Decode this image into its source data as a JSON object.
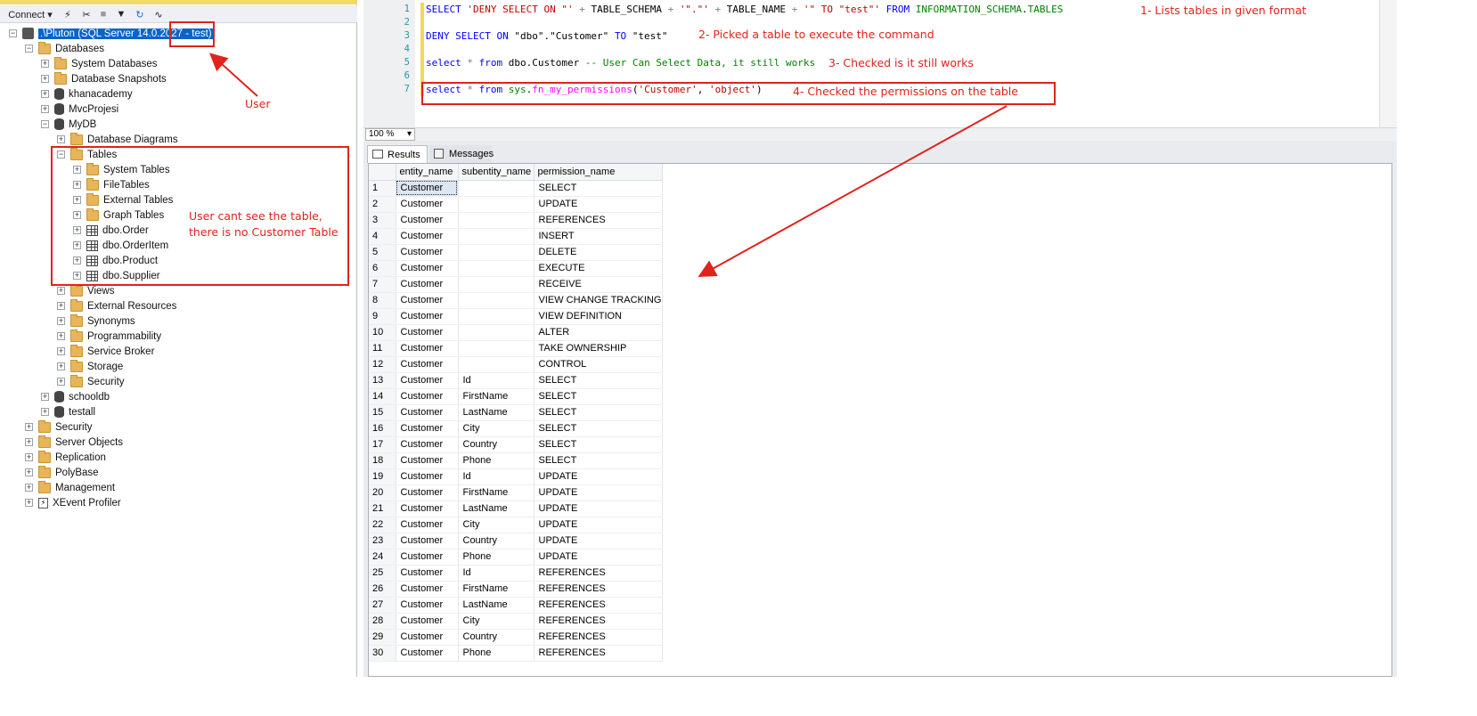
{
  "toolbar": {
    "connect_label": "Connect ▾"
  },
  "tree": {
    "server": ".\\Pluton (SQL Server 14.0.2027 - test)",
    "databases": "Databases",
    "system_databases": "System Databases",
    "database_snapshots": "Database Snapshots",
    "khanacademy": "khanacademy",
    "mvcprojesi": "MvcProjesi",
    "mydb": "MyDB",
    "database_diagrams": "Database Diagrams",
    "tables": "Tables",
    "system_tables": "System Tables",
    "filetables": "FileTables",
    "external_tables": "External Tables",
    "graph_tables": "Graph Tables",
    "dbo_order": "dbo.Order",
    "dbo_orderitem": "dbo.OrderItem",
    "dbo_product": "dbo.Product",
    "dbo_supplier": "dbo.Supplier",
    "views": "Views",
    "external_resources": "External Resources",
    "synonyms": "Synonyms",
    "programmability": "Programmability",
    "service_broker": "Service Broker",
    "storage": "Storage",
    "mydb_security": "Security",
    "schooldb": "schooldb",
    "testall": "testall",
    "security": "Security",
    "server_objects": "Server Objects",
    "replication": "Replication",
    "polybase": "PolyBase",
    "management": "Management",
    "xevent_profiler": "XEvent Profiler"
  },
  "editor": {
    "line_numbers": [
      "1",
      "2",
      "3",
      "4",
      "5",
      "6",
      "7"
    ],
    "zoom": "100 %"
  },
  "results": {
    "tab_results": "Results",
    "tab_messages": "Messages",
    "columns": [
      "entity_name",
      "subentity_name",
      "permission_name"
    ],
    "rows": [
      [
        "1",
        "Customer",
        "",
        "SELECT"
      ],
      [
        "2",
        "Customer",
        "",
        "UPDATE"
      ],
      [
        "3",
        "Customer",
        "",
        "REFERENCES"
      ],
      [
        "4",
        "Customer",
        "",
        "INSERT"
      ],
      [
        "5",
        "Customer",
        "",
        "DELETE"
      ],
      [
        "6",
        "Customer",
        "",
        "EXECUTE"
      ],
      [
        "7",
        "Customer",
        "",
        "RECEIVE"
      ],
      [
        "8",
        "Customer",
        "",
        "VIEW CHANGE TRACKING"
      ],
      [
        "9",
        "Customer",
        "",
        "VIEW DEFINITION"
      ],
      [
        "10",
        "Customer",
        "",
        "ALTER"
      ],
      [
        "11",
        "Customer",
        "",
        "TAKE OWNERSHIP"
      ],
      [
        "12",
        "Customer",
        "",
        "CONTROL"
      ],
      [
        "13",
        "Customer",
        "Id",
        "SELECT"
      ],
      [
        "14",
        "Customer",
        "FirstName",
        "SELECT"
      ],
      [
        "15",
        "Customer",
        "LastName",
        "SELECT"
      ],
      [
        "16",
        "Customer",
        "City",
        "SELECT"
      ],
      [
        "17",
        "Customer",
        "Country",
        "SELECT"
      ],
      [
        "18",
        "Customer",
        "Phone",
        "SELECT"
      ],
      [
        "19",
        "Customer",
        "Id",
        "UPDATE"
      ],
      [
        "20",
        "Customer",
        "FirstName",
        "UPDATE"
      ],
      [
        "21",
        "Customer",
        "LastName",
        "UPDATE"
      ],
      [
        "22",
        "Customer",
        "City",
        "UPDATE"
      ],
      [
        "23",
        "Customer",
        "Country",
        "UPDATE"
      ],
      [
        "24",
        "Customer",
        "Phone",
        "UPDATE"
      ],
      [
        "25",
        "Customer",
        "Id",
        "REFERENCES"
      ],
      [
        "26",
        "Customer",
        "FirstName",
        "REFERENCES"
      ],
      [
        "27",
        "Customer",
        "LastName",
        "REFERENCES"
      ],
      [
        "28",
        "Customer",
        "City",
        "REFERENCES"
      ],
      [
        "29",
        "Customer",
        "Country",
        "REFERENCES"
      ],
      [
        "30",
        "Customer",
        "Phone",
        "REFERENCES"
      ]
    ]
  },
  "annotations": {
    "user": "User",
    "cant_see_1": "User cant see the table,",
    "cant_see_2": "there is no Customer Table",
    "step1": "1- Lists tables in given format",
    "step2": "2- Picked a table to execute the command",
    "step3": "3- Checked is it still works",
    "step4": "4- Checked the permissions on the table"
  },
  "colors": {
    "annotation": "#e0231c",
    "selection": "#0a64c8",
    "keyword": "#0000ff",
    "string": "#c00000"
  }
}
